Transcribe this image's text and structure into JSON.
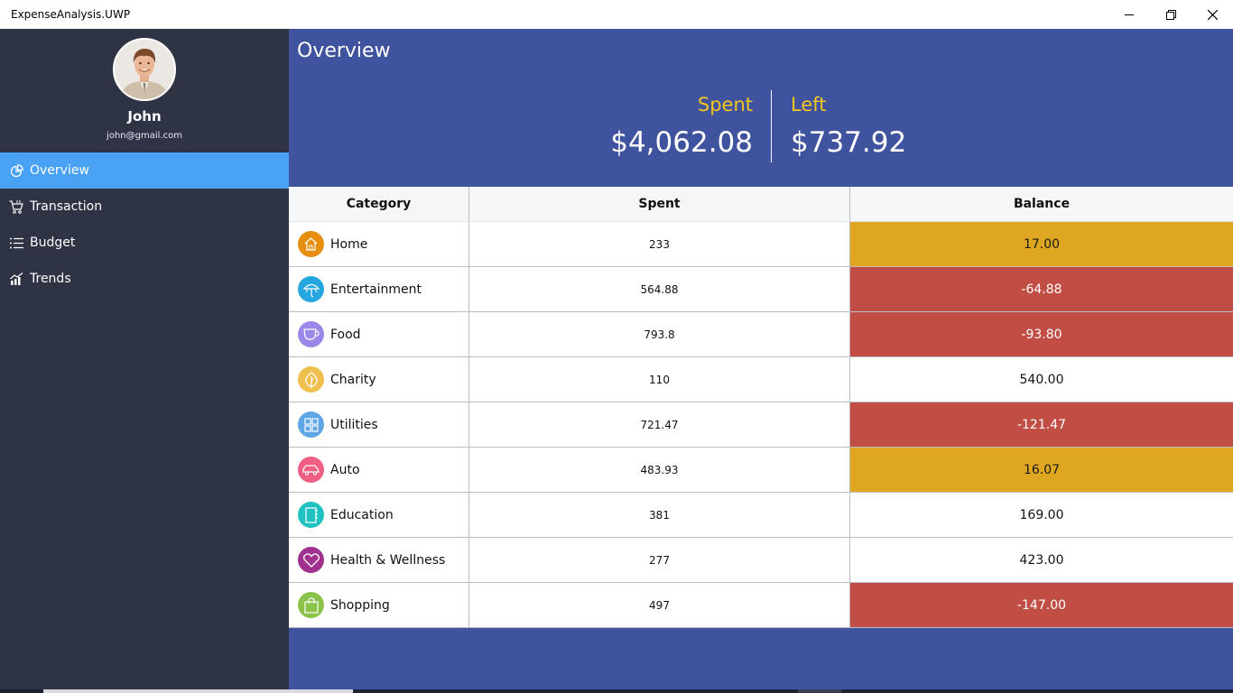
{
  "app": {
    "title": "ExpenseAnalysis.UWP"
  },
  "user": {
    "name": "John",
    "email": "john@gmail.com"
  },
  "sidebar": {
    "items": [
      {
        "label": "Overview",
        "icon": "pie-chart-icon",
        "active": true
      },
      {
        "label": "Transaction",
        "icon": "cart-icon",
        "active": false
      },
      {
        "label": "Budget",
        "icon": "list-icon",
        "active": false
      },
      {
        "label": "Trends",
        "icon": "trend-chart-icon",
        "active": false
      }
    ]
  },
  "main": {
    "title": "Overview",
    "summary": {
      "spent_label": "Spent",
      "spent_value": "$4,062.08",
      "left_label": "Left",
      "left_value": "$737.92"
    },
    "table": {
      "headers": [
        "Category",
        "Spent",
        "Balance"
      ],
      "rows": [
        {
          "category": "Home",
          "spent": "233",
          "balance": "17.00",
          "status": "warning",
          "icon": "home-icon",
          "icon_color": "#e58e0f"
        },
        {
          "category": "Entertainment",
          "spent": "564.88",
          "balance": "-64.88",
          "status": "over",
          "icon": "umbrella-icon",
          "icon_color": "#25a6e0"
        },
        {
          "category": "Food",
          "spent": "793.8",
          "balance": "-93.80",
          "status": "over",
          "icon": "cup-icon",
          "icon_color": "#9b87e8"
        },
        {
          "category": "Charity",
          "spent": "110",
          "balance": "540.00",
          "status": "ok",
          "icon": "leaf-icon",
          "icon_color": "#f0c04d"
        },
        {
          "category": "Utilities",
          "spent": "721.47",
          "balance": "-121.47",
          "status": "over",
          "icon": "grid-icon",
          "icon_color": "#5fa6e6"
        },
        {
          "category": "Auto",
          "spent": "483.93",
          "balance": "16.07",
          "status": "warning",
          "icon": "car-icon",
          "icon_color": "#ef5f84"
        },
        {
          "category": "Education",
          "spent": "381",
          "balance": "169.00",
          "status": "ok",
          "icon": "notebook-icon",
          "icon_color": "#1fc2c0"
        },
        {
          "category": "Health & Wellness",
          "spent": "277",
          "balance": "423.00",
          "status": "ok",
          "icon": "heart-icon",
          "icon_color": "#a0318f"
        },
        {
          "category": "Shopping",
          "spent": "497",
          "balance": "-147.00",
          "status": "over",
          "icon": "bag-icon",
          "icon_color": "#8bc34a"
        }
      ]
    }
  },
  "colors": {
    "sidebar_bg": "#2f3445",
    "active_nav": "#4aa2f5",
    "main_bg": "#40539e",
    "summary_label": "#f3c51f",
    "status_warning": "#dfa620",
    "status_over": "#c14e44",
    "status_ok": "#ffffff"
  }
}
